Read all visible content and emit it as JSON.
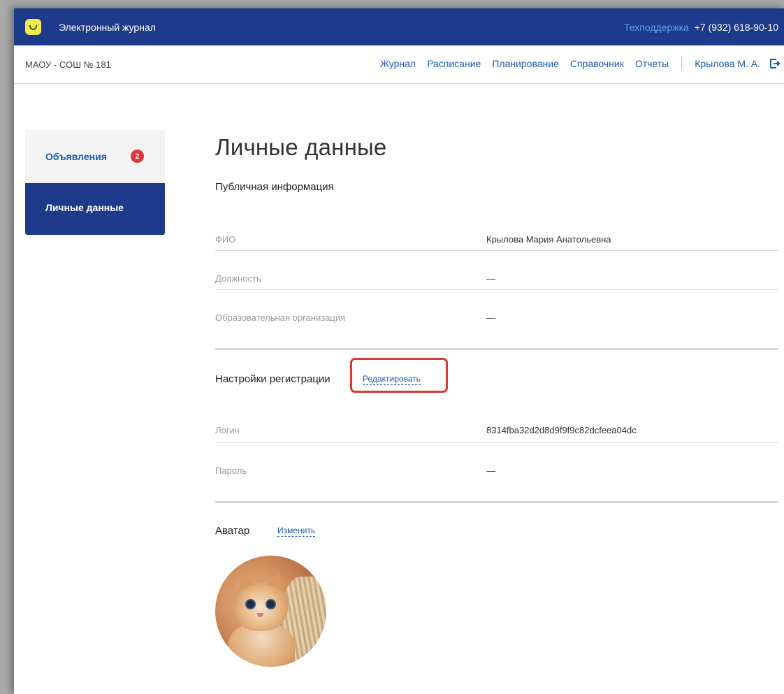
{
  "app": {
    "title": "Электронный журнал",
    "support_label": "Техподдержка",
    "support_phone": "+7 (932) 618-90-10"
  },
  "nav": {
    "school": "МАОУ - СОШ № 181",
    "links": [
      "Журнал",
      "Расписание",
      "Планирование",
      "Справочник",
      "Отчеты"
    ],
    "user": "Крылова М. А."
  },
  "sidebar": {
    "items": [
      {
        "label": "Объявления",
        "badge": "2"
      },
      {
        "label": "Личные данные"
      }
    ]
  },
  "main": {
    "title": "Личные данные",
    "public": {
      "title": "Публичная информация",
      "rows": [
        {
          "label": "ФИО",
          "value": "Крылова Мария Анатольевна"
        },
        {
          "label": "Должность",
          "value": "—"
        },
        {
          "label": "Образовательная организация",
          "value": "—"
        }
      ]
    },
    "registration": {
      "title": "Настройки регистрации",
      "edit_label": "Редактировать",
      "rows": [
        {
          "label": "Логин",
          "value": "8314fba32d2d8d9f9f9c82dcfeea04dc"
        },
        {
          "label": "Пароль",
          "value": "—"
        }
      ]
    },
    "avatar": {
      "title": "Аватар",
      "change_label": "Изменить"
    }
  },
  "colors": {
    "brand_blue": "#1e3a8a",
    "link_blue": "#1c5ab0",
    "badge_red": "#e6333a",
    "highlight_red": "#d93a32"
  }
}
